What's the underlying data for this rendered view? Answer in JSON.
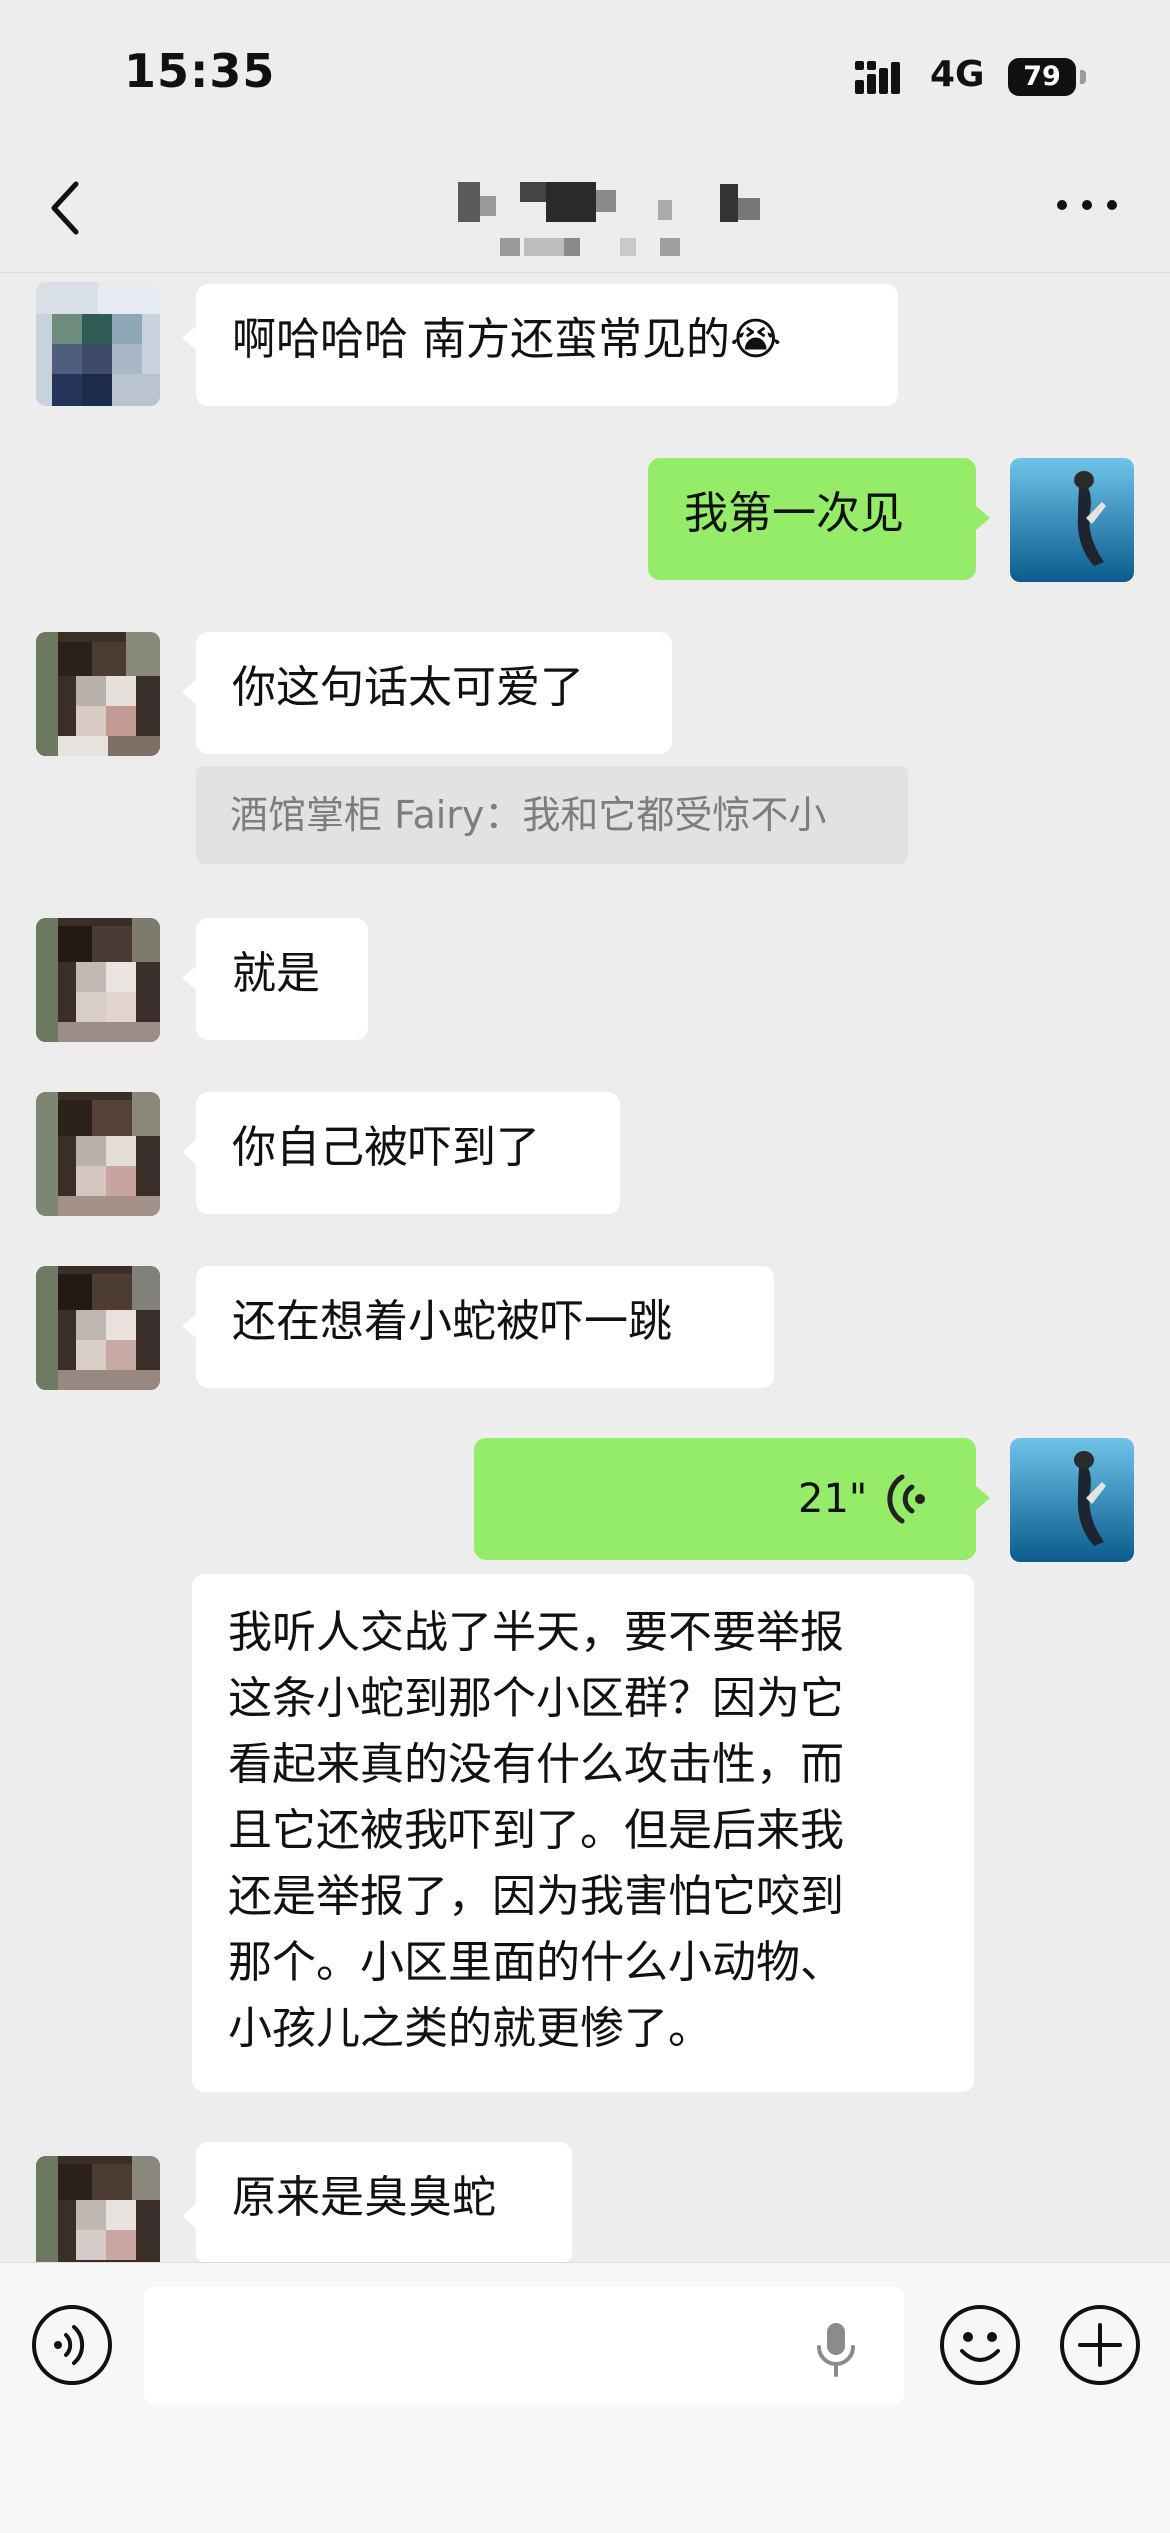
{
  "status_bar": {
    "time": "15:35",
    "network": "4G",
    "battery": "79"
  },
  "header": {
    "back_icon": "chevron-left-icon",
    "more_icon": "more-horizontal-icon"
  },
  "messages": [
    {
      "side": "in",
      "text": "啊哈哈哈 南方还蛮常见的😭"
    },
    {
      "side": "out",
      "text": "我第一次见"
    },
    {
      "side": "in",
      "text": "你这句话太可爱了",
      "quote": "酒馆掌柜 Fairy：我和它都受惊不小"
    },
    {
      "side": "in",
      "text": "就是"
    },
    {
      "side": "in",
      "text": "你自己被吓到了"
    },
    {
      "side": "in",
      "text": "还在想着小蛇被吓一跳"
    },
    {
      "side": "out",
      "type": "voice",
      "duration": "21\""
    },
    {
      "side": "in",
      "type": "transcript",
      "lines": [
        "我听人交战了半天，要不要举报",
        "这条小蛇到那个小区群？因为它",
        "看起来真的没有什么攻击性，而",
        "且它还被我吓到了。但是后来我",
        "还是举报了，因为我害怕它咬到",
        "那个。小区里面的什么小动物、",
        "小孩儿之类的就更惨了。"
      ]
    },
    {
      "side": "in",
      "text": "原来是臭臭蛇"
    }
  ],
  "input_bar": {
    "voice_icon": "voice-input-icon",
    "mic_icon": "microphone-icon",
    "emoji_icon": "emoji-icon",
    "plus_icon": "plus-circle-icon"
  }
}
